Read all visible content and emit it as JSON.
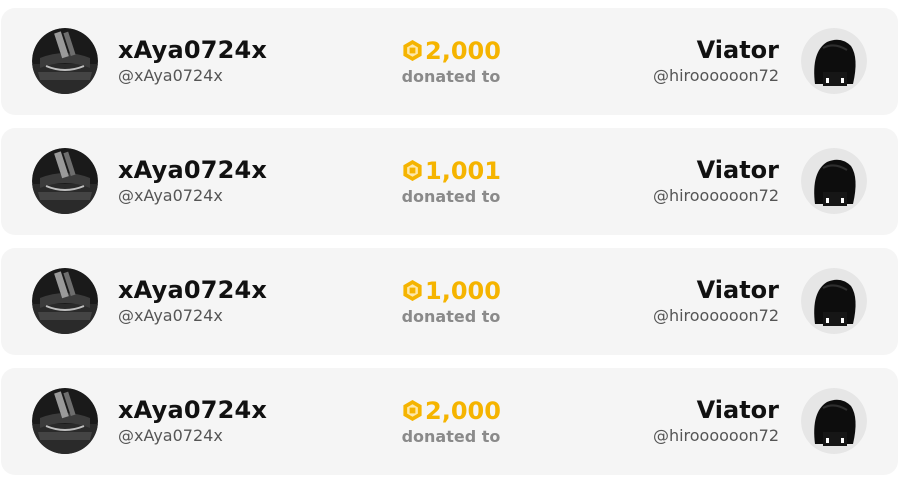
{
  "donations": [
    {
      "donor": {
        "display_name": "xAya0724x",
        "handle": "@xAya0724x"
      },
      "amount": "2,000",
      "currency_icon": "robux-icon",
      "label": "donated to",
      "recipient": {
        "display_name": "Viator",
        "handle": "@hiroooooon72"
      }
    },
    {
      "donor": {
        "display_name": "xAya0724x",
        "handle": "@xAya0724x"
      },
      "amount": "1,001",
      "currency_icon": "robux-icon",
      "label": "donated to",
      "recipient": {
        "display_name": "Viator",
        "handle": "@hiroooooon72"
      }
    },
    {
      "donor": {
        "display_name": "xAya0724x",
        "handle": "@xAya0724x"
      },
      "amount": "1,000",
      "currency_icon": "robux-icon",
      "label": "donated to",
      "recipient": {
        "display_name": "Viator",
        "handle": "@hiroooooon72"
      }
    },
    {
      "donor": {
        "display_name": "xAya0724x",
        "handle": "@xAya0724x"
      },
      "amount": "2,000",
      "currency_icon": "robux-icon",
      "label": "donated to",
      "recipient": {
        "display_name": "Viator",
        "handle": "@hiroooooon72"
      }
    }
  ],
  "colors": {
    "card_background": "#f5f5f5",
    "amount": "#f5b400",
    "name": "#111111",
    "handle": "#555555",
    "label": "#8a8a8a"
  }
}
